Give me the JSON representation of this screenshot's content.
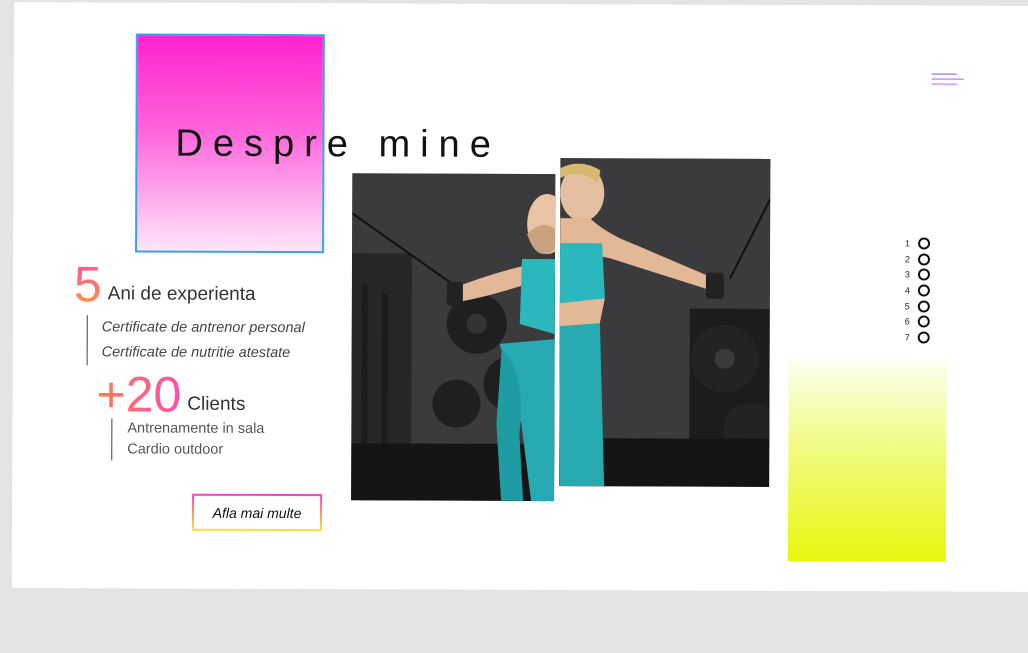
{
  "header": {
    "title": "Despre mine",
    "menu_icon": "hamburger-menu-icon"
  },
  "stats": [
    {
      "number": "5",
      "label": "Ani de experienta",
      "items": [
        "Certificate de antrenor personal",
        "Certificate de nutritie atestate"
      ]
    },
    {
      "number": "+20",
      "label": "Clients",
      "items": [
        "Antrenamente in sala",
        "Cardio outdoor"
      ]
    }
  ],
  "cta": {
    "label": "Afla mai multe"
  },
  "pagination": {
    "labels": [
      "1",
      "2",
      "3",
      "4",
      "5",
      "6",
      "7"
    ]
  },
  "colors": {
    "accent_pink": "#ff22cf",
    "accent_blue_border": "#3aa0f0",
    "accent_yellow": "#e6f70e",
    "outfit_teal": "#2ab7bd"
  }
}
